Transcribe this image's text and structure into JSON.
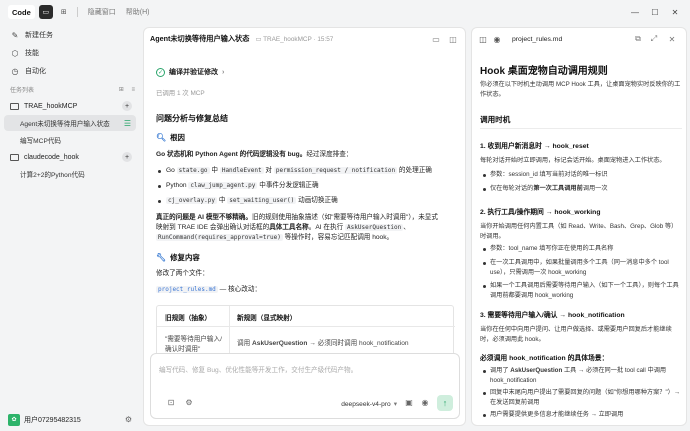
{
  "titlebar": {
    "app_label": "Code",
    "menu_hidden": "隐藏窗口",
    "menu_help": "帮助(H)",
    "win_min": "—",
    "win_max": "☐",
    "win_close": "✕"
  },
  "sidebar": {
    "new_task": "新建任务",
    "skills": "技能",
    "automation": "自动化",
    "section_title": "任务列表",
    "projects": [
      {
        "name": "TRAE_hookMCP",
        "tasks": [
          "Agent未切换等待用户输入状态",
          "编写MCP代码"
        ]
      },
      {
        "name": "claudecode_hook",
        "tasks": [
          "计算2+2的Python代码"
        ]
      }
    ],
    "user": "用户07295482315"
  },
  "chat": {
    "title": "Agent未切换等待用户输入状态",
    "crumb": "TRAE_hookMCP · 15:57",
    "verify_label": "编译并验证修改",
    "mcp_called": "已调用 1 次 MCP",
    "summary_heading": "问题分析与修复总结",
    "root_heading": "根因",
    "root_intro_pre": "Go 状态机和 Python Agent 的代码逻辑没有 bug。",
    "root_intro_post": "经过深度排查：",
    "bullets": [
      {
        "pre": "Go",
        "code1": "state.go",
        "mid": "中",
        "code2": "HandleEvent",
        "mid2": "对",
        "code3": "permission_request / notification",
        "post": "的处理正确"
      },
      {
        "pre": "Python",
        "code1": "claw_jump_agent.py",
        "post": "中事件分发逻辑正确"
      },
      {
        "code1": "cj_overlay.py",
        "mid": "中",
        "code2": "set_waiting_user()",
        "post": "动画切换正确"
      }
    ],
    "real_problem_1_bold": "真正的问题是 AI 模型不够精确。",
    "real_problem_1_rest": "旧的规则使用抽象描述（如\"需要等待用户输入时调用\"），未显式",
    "real_problem_2_pre": "映射到 TRAE IDE 会弹出确认对话框的",
    "real_problem_2_bold": "具体工具名称",
    "real_problem_2_mid": "。AI 在执行",
    "real_problem_2_code": "AskUserQuestion",
    "real_problem_3_code": "RunCommand(requires_approval=true)",
    "real_problem_3_rest": "等操作时，容易忘记匹配调用 hook。",
    "fix_heading": "修复内容",
    "fix_intro": "修改了两个文件：",
    "fix_file": "project_rules.md",
    "fix_file_suffix": "— 核心改动：",
    "table": {
      "headers": [
        "旧规则（抽象）",
        "新规则（显式映射）"
      ],
      "row1_col1_a": "\"需要等待用户输入/",
      "row1_col1_b": "确认时调用\"",
      "row1_col2_pre": "调用",
      "row1_col2_bold": "AskUserQuestion",
      "row1_col2_post": "→ 必须同时调用 hook_notification"
    },
    "input_placeholder": "编写代码、修复 Bug、优化性能等开发工作，交付生产级代码产物。",
    "model": "deepseek-v4-pro"
  },
  "doc": {
    "filename": "project_rules.md",
    "h1": "Hook 桌面宠物自动调用规则",
    "intro": "你必须在以下时机主动调用 MCP Hook 工具，让桌面宠物实时反映你的工作状态。",
    "h2": "调用时机",
    "s1_title": "1. 收到用户新消息时 → hook_reset",
    "s1_desc": "每轮对话开始时立即调用，标记会话开始。桌面宠物进入工作状态。",
    "s1_items": [
      "参数：session_id 填写当前对话的唯一标识",
      "仅在每轮对话的第一次工具调用前调用一次"
    ],
    "s1_item2_pre": "仅在每轮对话的",
    "s1_item2_bold": "第一次工具调用前",
    "s1_item2_post": "调用一次",
    "s2_title": "2. 执行工具/操作期间 → hook_working",
    "s2_desc": "当你开始调用任何内置工具（如 Read、Write、Bash、Grep、Glob 等）时调用。",
    "s2_items": [
      "参数：tool_name 填写你正在使用的工具名称",
      "在一次工具调用中，如果批量调用多个工具（同一消息中多个 tool use），只需调用一次 hook_working",
      "如果一个工具调用后需要等待用户输入（如下一个工具），则每个工具调用前都要调用 hook_working"
    ],
    "s3_title": "3. 需要等待用户输入/确认 → hook_notification",
    "s3_desc": "当你在任何中向用户提问、让用户做选择、或需要用户回复后才能继续时，必须调用此 hook。",
    "s3_sub": "必须调用 hook_notification 的具体场景：",
    "s3_items": [
      "调用了 AskUserQuestion 工具 → 必须在同一批 tool call 中调用 hook_notification",
      "回复中末尾向用户提出了需要回复的问题（如\"你想用哪种方案？\"）→ 在发送回复前调用",
      "用户需要提供更多信息才能继续任务 → 立即调用"
    ],
    "s3_item1_pre": "调用了",
    "s3_item1_bold": "AskUserQuestion",
    "s3_item1_post": "工具 → 必须在同一批 tool call 中调用 hook_notification"
  }
}
